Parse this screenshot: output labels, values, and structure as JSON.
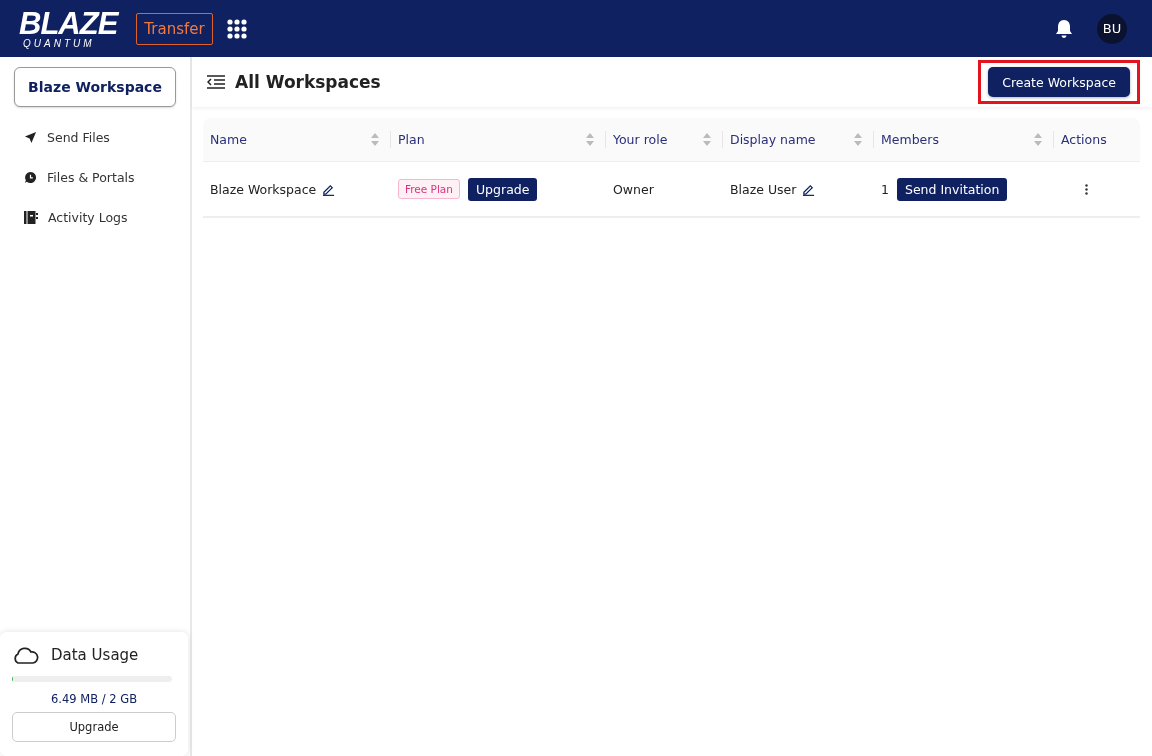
{
  "header": {
    "logo": {
      "title": "BLAZE",
      "subtitle": "QUANTUM"
    },
    "app_button": "Transfer",
    "avatar": "BU"
  },
  "sidebar": {
    "workspace_button": "Blaze Workspace",
    "items": [
      {
        "label": "Send Files",
        "kind": "send"
      },
      {
        "label": "Files & Portals",
        "kind": "chat"
      },
      {
        "label": "Activity Logs",
        "kind": "log"
      }
    ],
    "data_usage": {
      "title": "Data Usage",
      "level": 0.004,
      "reading": "6.49 MB / 2 GB",
      "button": "Upgrade"
    }
  },
  "page": {
    "title": "All Workspaces",
    "create_button": {
      "label": "Create Workspace",
      "highlighted": true
    }
  },
  "table": {
    "columns": [
      {
        "label": "Name",
        "sortable": true
      },
      {
        "label": "Plan",
        "sortable": true
      },
      {
        "label": "Your role",
        "sortable": true
      },
      {
        "label": "Display name",
        "sortable": true
      },
      {
        "label": "Members",
        "sortable": true
      },
      {
        "label": "Actions",
        "sortable": false
      }
    ],
    "rows": [
      {
        "name": "Blaze Workspace",
        "plan_badge": "Free Plan",
        "upgrade_button": "Upgrade",
        "role": "Owner",
        "display_name": "Blaze User",
        "members": "1",
        "invite_button": "Send Invitation"
      }
    ]
  }
}
